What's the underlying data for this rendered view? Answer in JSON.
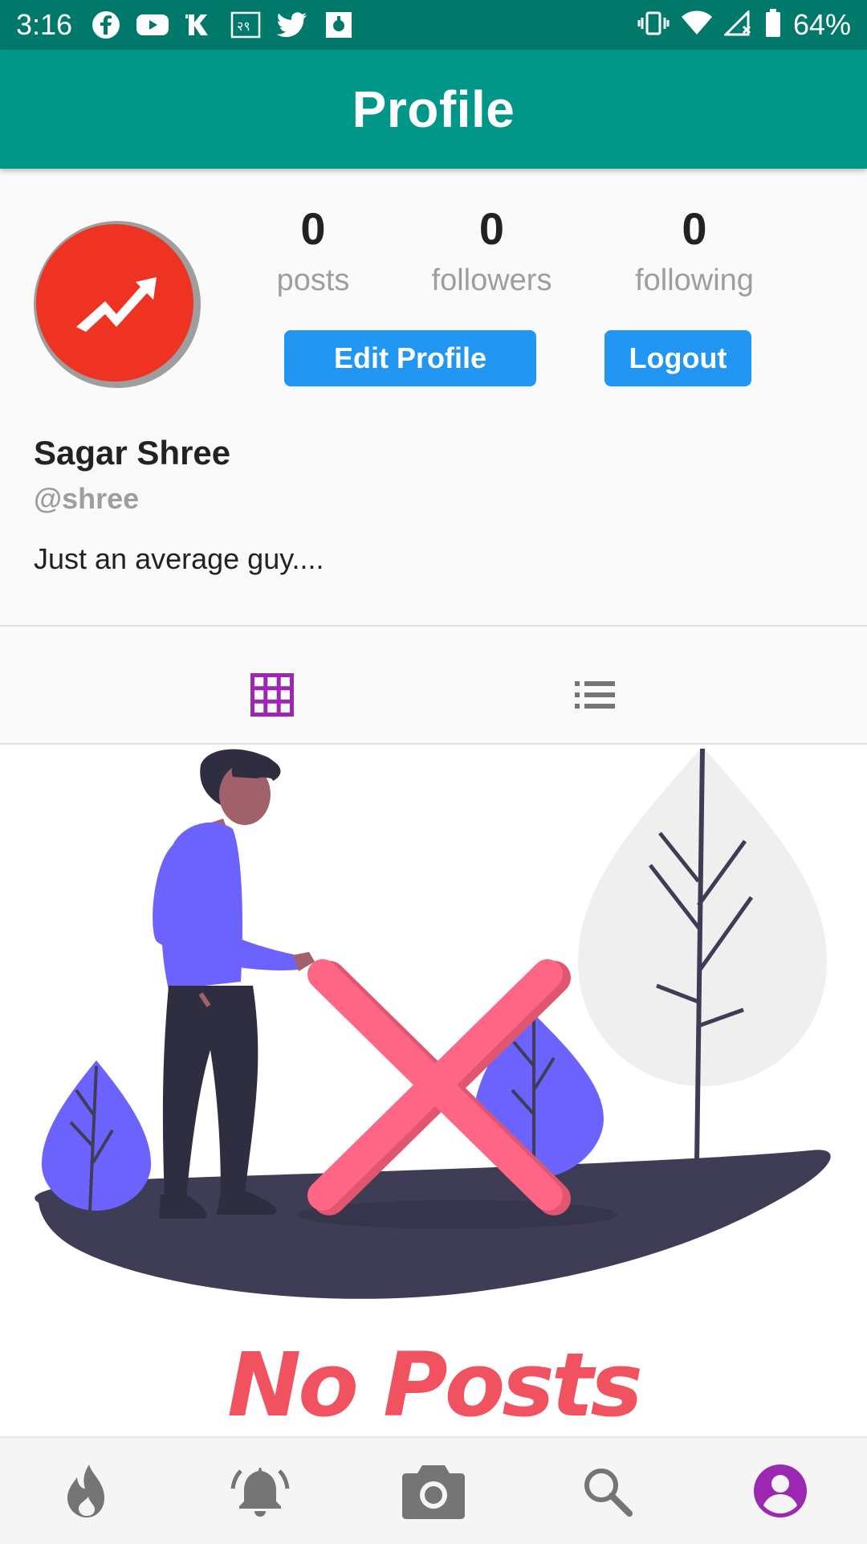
{
  "status_bar": {
    "time": "3:16",
    "battery_percent": "64%",
    "left_icons": [
      "facebook-icon",
      "youtube-icon",
      "k-app-icon",
      "news-app-icon",
      "twitter-icon",
      "notification-app-icon"
    ],
    "right_icons": [
      "vibrate-icon",
      "wifi-icon",
      "signal-icon",
      "battery-icon"
    ]
  },
  "app_bar": {
    "title": "Profile"
  },
  "profile": {
    "stats": [
      {
        "count": "0",
        "label": "posts"
      },
      {
        "count": "0",
        "label": "followers"
      },
      {
        "count": "0",
        "label": "following"
      }
    ],
    "edit_button": "Edit Profile",
    "logout_button": "Logout",
    "display_name": "Sagar Shree",
    "username": "@shree",
    "bio": "Just an average guy...."
  },
  "view_toggle": {
    "options": [
      "grid-view",
      "list-view"
    ],
    "active": "grid-view",
    "active_color": "#9c27b0",
    "inactive_color": "#757575"
  },
  "empty_state": {
    "text": "No Posts"
  },
  "bottom_nav": {
    "items": [
      "timeline-icon",
      "notifications-icon",
      "camera-icon",
      "search-icon",
      "profile-icon"
    ],
    "active": "profile-icon",
    "active_color": "#9c27b0",
    "inactive_color": "#757575"
  },
  "colors": {
    "status_bar": "#00796b",
    "app_bar": "#009688",
    "button": "#2196f3",
    "avatar": "#ee3322",
    "empty_text": "#f0525f"
  }
}
